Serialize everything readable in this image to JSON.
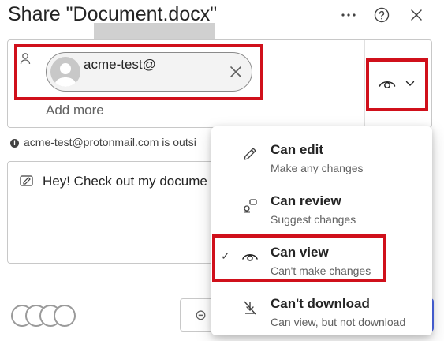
{
  "dialog": {
    "title": "Share \"Document.docx\"",
    "more_icon": "more-horizontal-icon",
    "help_icon": "help-circle-icon",
    "close_icon": "close-icon"
  },
  "recipients": {
    "chip": {
      "name": "acme-test@",
      "redacted": true,
      "remove_icon": "dismiss-icon"
    },
    "add_more_placeholder": "Add more",
    "permission_selector": {
      "icon": "eye-icon",
      "chevron": "chevron-down-icon",
      "selected": "Can view"
    }
  },
  "info_text": "acme-test@protonmail.com is outsi",
  "message": {
    "text": "Hey! Check out my docume",
    "icon": "edit-message-icon"
  },
  "permission_options": [
    {
      "title": "Can edit",
      "description": "Make any changes",
      "icon": "pencil-icon",
      "selected": false
    },
    {
      "title": "Can review",
      "description": "Suggest changes",
      "icon": "review-icon",
      "selected": false
    },
    {
      "title": "Can view",
      "description": "Can't make changes",
      "icon": "eye-icon",
      "selected": true
    },
    {
      "title": "Can't download",
      "description": "Can view, but not download",
      "icon": "no-download-icon",
      "selected": false
    }
  ],
  "highlight_color": "#d0101b",
  "send_color": "#4f6bed"
}
